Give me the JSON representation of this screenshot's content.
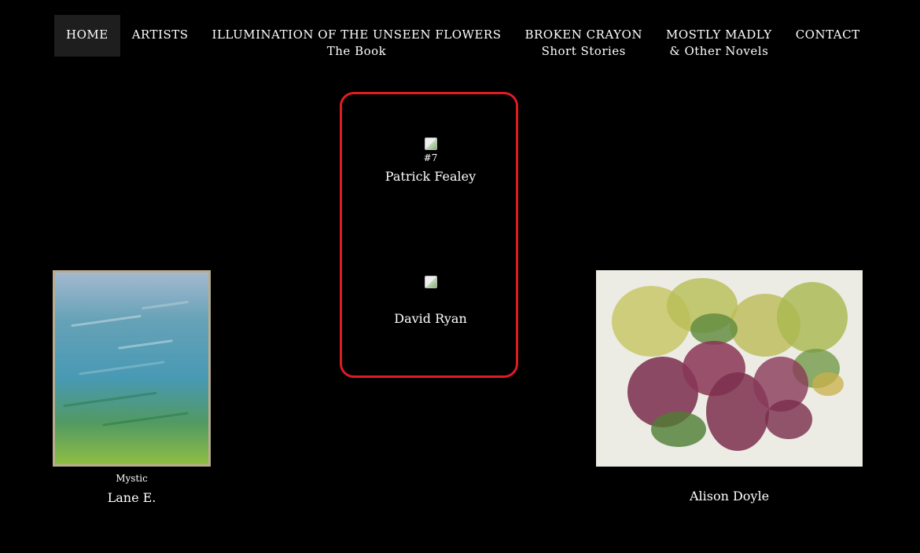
{
  "nav": {
    "items": [
      {
        "label": "HOME",
        "sub": ""
      },
      {
        "label": "ARTISTS",
        "sub": ""
      },
      {
        "label": "ILLUMINATION OF THE UNSEEN FLOWERS",
        "sub": "The Book"
      },
      {
        "label": "BROKEN CRAYON",
        "sub": "Short Stories"
      },
      {
        "label": "MOSTLY MADLY",
        "sub": "& Other Novels"
      },
      {
        "label": "CONTACT",
        "sub": ""
      }
    ]
  },
  "gallery": {
    "center_top": {
      "caption": "#7",
      "artist": "Patrick Fealey"
    },
    "center_bottom": {
      "caption": "",
      "artist": "David Ryan"
    },
    "left": {
      "caption": "Mystic",
      "artist": "Lane E."
    },
    "right": {
      "caption": "",
      "artist": "Alison Doyle"
    }
  },
  "colors": {
    "background": "#000000",
    "highlight_border": "#e01b24",
    "active_nav_bg": "#1e1e1e",
    "text": "#ffffff"
  }
}
